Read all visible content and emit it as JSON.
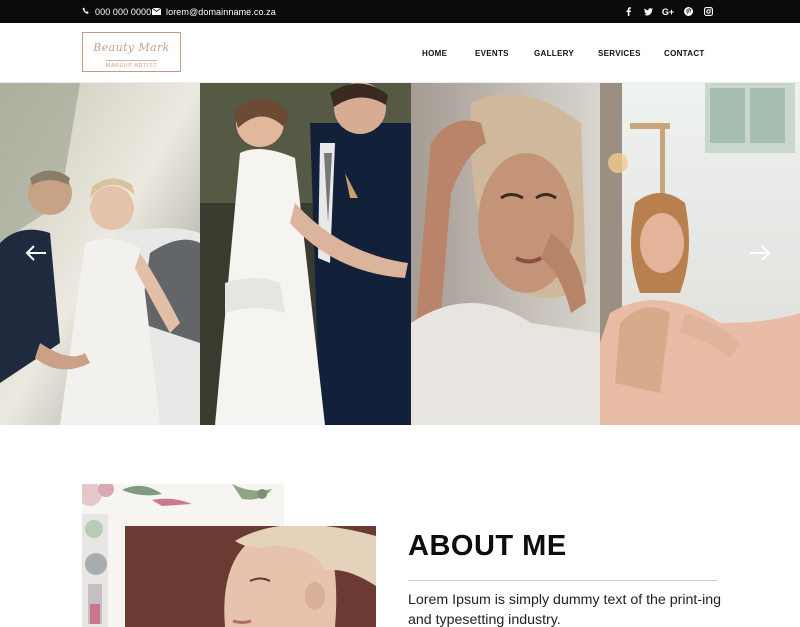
{
  "topbar": {
    "phone": "000 000 0000",
    "email": "lorem@domainname.co.za",
    "social_icons": [
      "facebook-icon",
      "twitter-icon",
      "google-plus-icon",
      "pinterest-icon",
      "instagram-icon"
    ],
    "google_plus_label": "G+"
  },
  "logo": {
    "script": "Beauty Mark",
    "subtitle": "MAKEUP ARTIST"
  },
  "nav": {
    "items": [
      "HOME",
      "EVENTS",
      "GALLERY",
      "SERVICES",
      "CONTACT"
    ]
  },
  "slider": {
    "prev_icon": "arrow-left-icon",
    "next_icon": "arrow-right-icon"
  },
  "about": {
    "title": "ABOUT ME",
    "text": "Lorem Ipsum is simply dummy text of the print-ing and typesetting industry."
  },
  "colors": {
    "topbar_bg": "#0b0b0b",
    "logo_accent": "#c7a090",
    "photo_backdrop": "#6b3a33"
  }
}
